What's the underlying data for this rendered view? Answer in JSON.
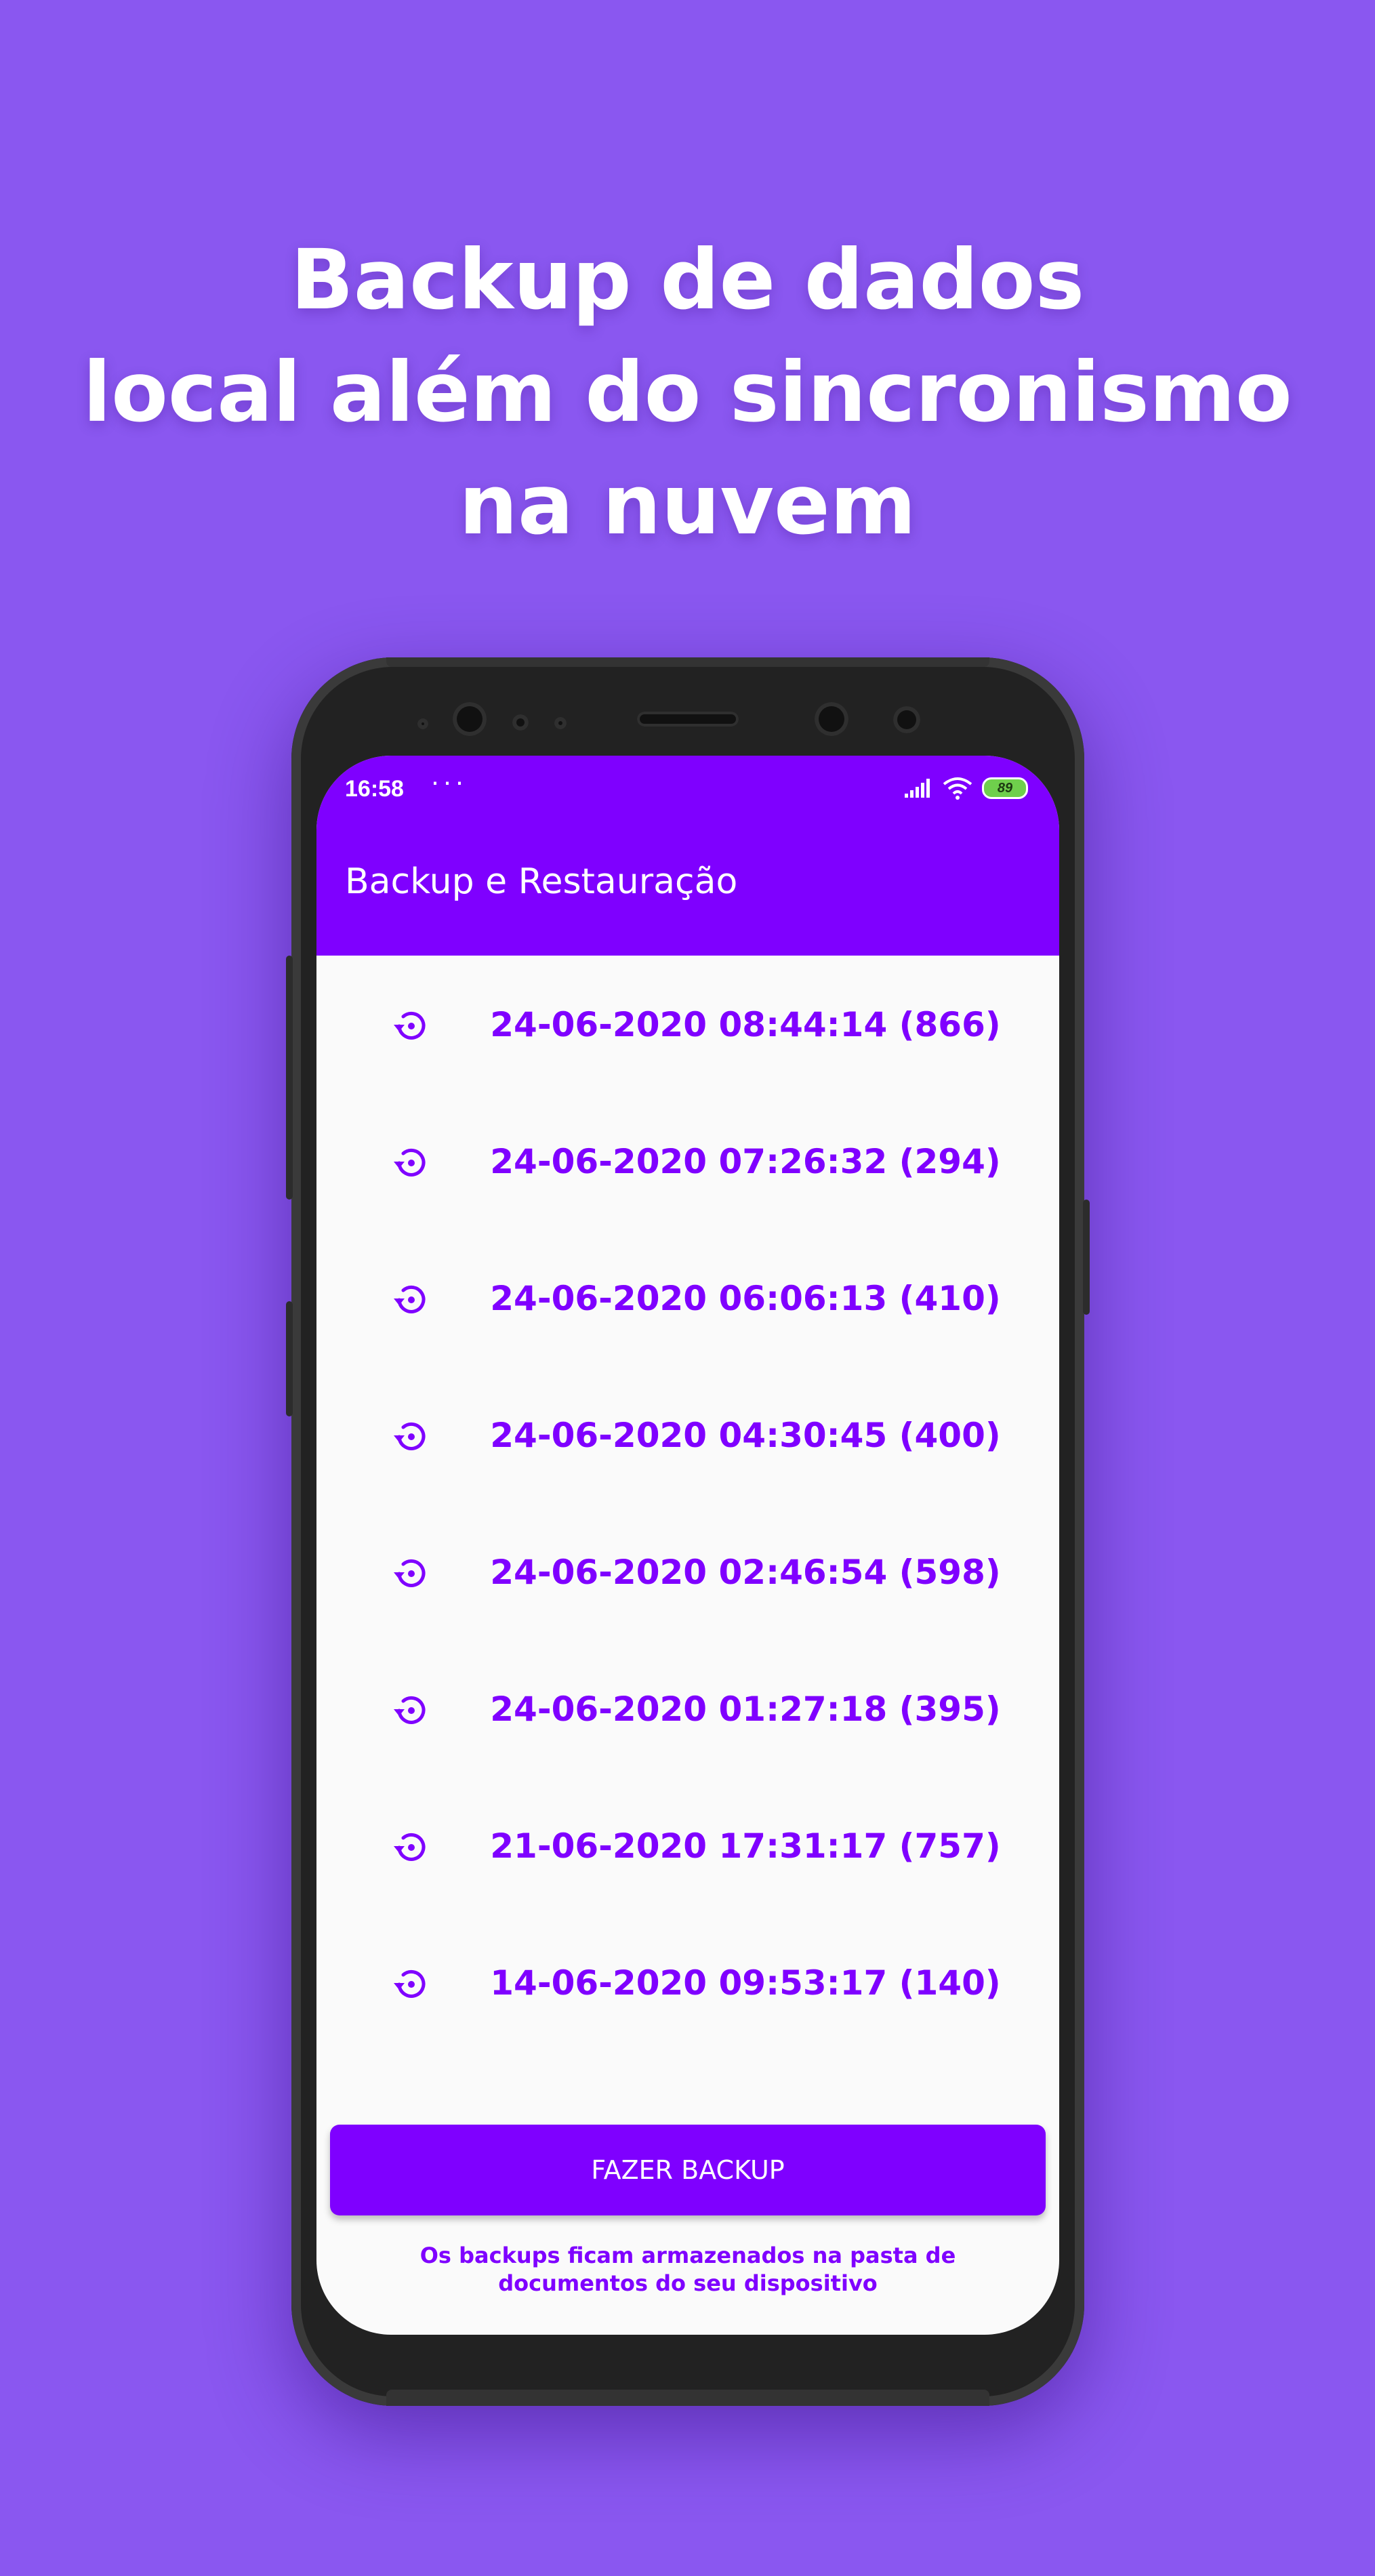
{
  "headline": {
    "line1": "Backup de dados",
    "line2": "local além do sincronismo",
    "line3": "na nuvem"
  },
  "status_bar": {
    "time": "16:58",
    "more": "···",
    "battery": "89"
  },
  "app_bar": {
    "title": "Backup e Restauração"
  },
  "backups": [
    "24-06-2020 08:44:14 (866)",
    "24-06-2020 07:26:32 (294)",
    "24-06-2020 06:06:13 (410)",
    "24-06-2020 04:30:45 (400)",
    "24-06-2020 02:46:54 (598)",
    "24-06-2020 01:27:18 (395)",
    "21-06-2020 17:31:17 (757)",
    "14-06-2020 09:53:17 (140)"
  ],
  "backup_button": "FAZER BACKUP",
  "footer_note": "Os backups ficam armazenados na pasta de documentos do seu dispositivo",
  "colors": {
    "background": "#8a57f0",
    "accent": "#7f00ff",
    "screen": "#fafafa"
  },
  "icons": {
    "row": "restore-icon",
    "signal": "signal-icon",
    "wifi": "wifi-icon",
    "battery": "battery-icon"
  }
}
